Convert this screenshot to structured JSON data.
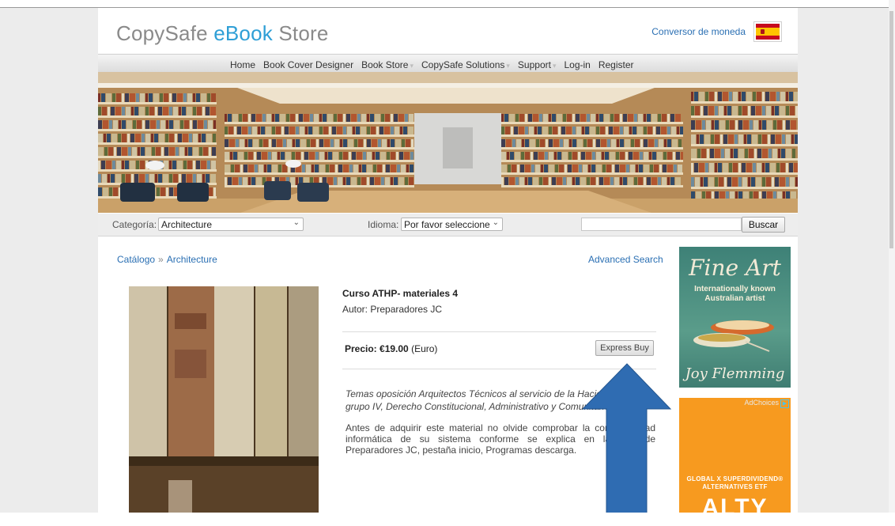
{
  "header": {
    "logo_part1": "CopySafe ",
    "logo_part2": "eBook",
    "logo_part3": " Store",
    "currency_link": "Conversor de moneda",
    "flag_icon": "spain-flag-icon"
  },
  "nav": {
    "items": [
      {
        "label": "Home",
        "dropdown": false
      },
      {
        "label": "Book Cover Designer",
        "dropdown": false
      },
      {
        "label": "Book Store",
        "dropdown": true
      },
      {
        "label": "CopySafe Solutions",
        "dropdown": true
      },
      {
        "label": "Support",
        "dropdown": true
      },
      {
        "label": "Log-in",
        "dropdown": false
      },
      {
        "label": "Register",
        "dropdown": false
      }
    ]
  },
  "filter": {
    "category_label": "Categoría:",
    "category_value": "Architecture",
    "language_label": "Idioma:",
    "language_value": "Por favor seleccione",
    "search_value": "",
    "search_button": "Buscar"
  },
  "breadcrumb": {
    "catalog": "Catálogo",
    "separator": "»",
    "current": "Architecture"
  },
  "advanced_search": "Advanced Search",
  "product": {
    "title": "Curso ATHP- materiales 4",
    "author": "Autor: Preparadores JC",
    "price_label": "Precio:",
    "price_value": "€19.00",
    "price_currency": "(Euro)",
    "express_buy": "Express Buy",
    "description_italic": "Temas oposición Arquitectos Técnicos al servicio de la Hacienda Pública, grupo IV, Derecho Constitucional, Administrativo y Comunitario.",
    "description_plain": "Antes de adquirir este material no olvide comprobar la compatibilidad informática de su sistema conforme se explica en la web de Preparadores JC, pestaña inicio, Programas descarga."
  },
  "ads": {
    "ad1_title": "Fine Art",
    "ad1_subtitle": "Internationally known Australian artist",
    "ad1_name": "Joy Flemming",
    "ad2_choices": "AdChoices",
    "ad2_tagline": "GLOBAL X SUPERDIVIDEND® ALTERNATIVES ETF",
    "ad2_big": "ALTY"
  },
  "colors": {
    "link": "#2a6fb3",
    "logo_accent": "#2f9fd6",
    "arrow": "#2f6cb2",
    "ad2_bg": "#f79a1f"
  }
}
